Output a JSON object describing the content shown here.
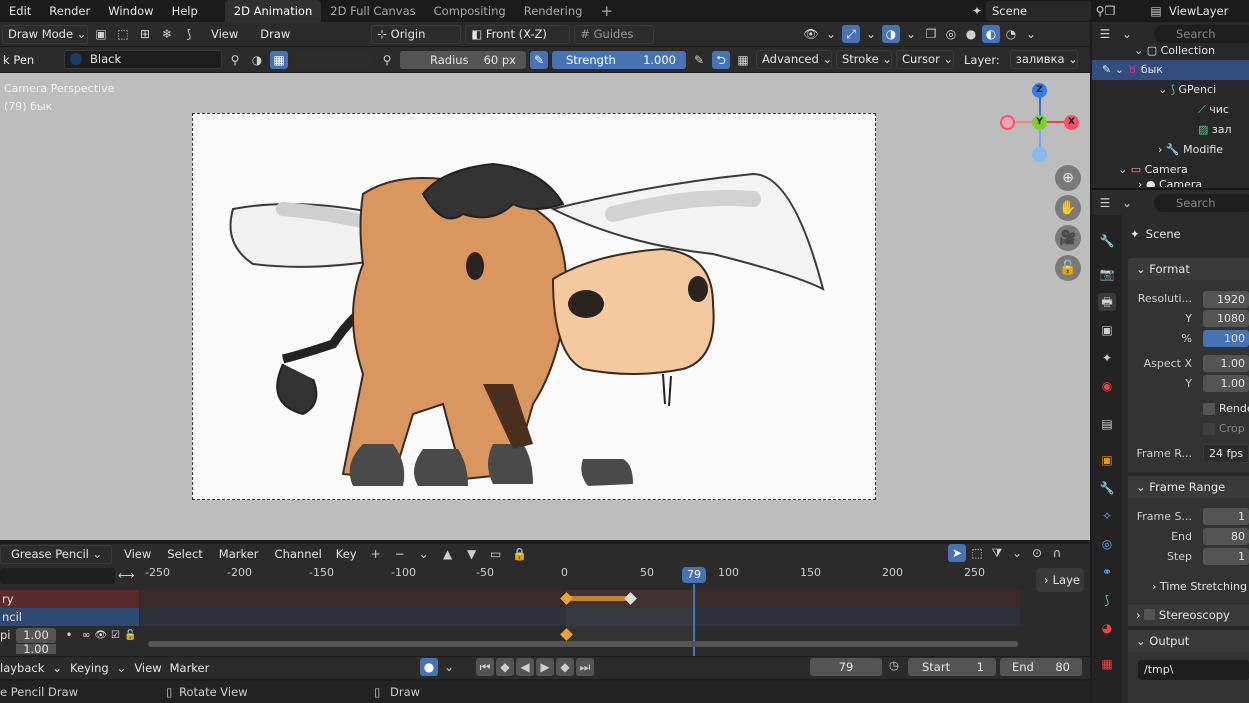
{
  "menus": [
    "Edit",
    "Render",
    "Window",
    "Help"
  ],
  "workspaces": [
    {
      "label": "2D Animation",
      "active": true
    },
    {
      "label": "2D Full Canvas",
      "active": false
    },
    {
      "label": "Compositing",
      "active": false
    },
    {
      "label": "Rendering",
      "active": false
    }
  ],
  "workspace_add": "+",
  "scene_name": "Scene",
  "view_layer_name": "ViewLayer",
  "toolbar1": {
    "mode": "Draw Mode",
    "view": "View",
    "draw": "Draw",
    "origin": "Origin",
    "front": "Front (X-Z)",
    "guides": "Guides"
  },
  "toolbar2": {
    "tool": "k Pen",
    "material": "Black",
    "radius_label": "Radius",
    "radius_value": "60 px",
    "strength_label": "Strength",
    "strength_value": "1.000",
    "advanced": "Advanced",
    "stroke": "Stroke",
    "cursor": "Cursor",
    "layer_label": "Layer:",
    "layer_value": "заливка"
  },
  "viewport": {
    "overlay_line1": "Camera Perspective",
    "overlay_line2": "(79) бык",
    "gizmo": {
      "z": "Z",
      "y": "Y",
      "x": "X"
    }
  },
  "dopesheet": {
    "mode": "Grease Pencil",
    "menus": [
      "View",
      "Select",
      "Marker",
      "Channel",
      "Key"
    ],
    "ruler": [
      "-250",
      "-200",
      "-150",
      "-100",
      "-50",
      "0",
      "50",
      "100",
      "150",
      "200",
      "250"
    ],
    "current_frame": "79",
    "channels": [
      {
        "label": "ry"
      },
      {
        "label": "ncil"
      },
      {
        "label": "pi",
        "value": "1.00"
      },
      {
        "label": "",
        "value": "1.00"
      }
    ],
    "layers_btn": "Laye"
  },
  "playback": {
    "playback": "layback",
    "keying": "Keying",
    "view": "View",
    "marker": "Marker",
    "frame": "79",
    "start_label": "Start",
    "start": "1",
    "end_label": "End",
    "end": "80"
  },
  "status": {
    "left": "e Pencil Draw",
    "middle": "Rotate View",
    "right": "Draw"
  },
  "outliner": {
    "search_placeholder": "Search",
    "items": [
      {
        "label": "Collection"
      },
      {
        "label": "бык"
      },
      {
        "label": "GPenci"
      },
      {
        "label": "чис"
      },
      {
        "label": "зал"
      },
      {
        "label": "Modifie"
      },
      {
        "label": "Camera"
      },
      {
        "label": "Camera"
      }
    ]
  },
  "properties": {
    "search_placeholder": "Search",
    "scene": "Scene",
    "format": "Format",
    "resolution_label": "Resoluti...",
    "res_x": "1920",
    "y_label": "Y",
    "res_y": "1080",
    "pct_label": "%",
    "res_pct": "100",
    "aspect_x_label": "Aspect X",
    "aspect_x": "1.00",
    "aspect_y_label": "Y",
    "aspect_y": "1.00",
    "render_region": "Rende",
    "crop": "Crop",
    "frame_rate_label": "Frame R...",
    "frame_rate": "24 fps",
    "frame_range": "Frame Range",
    "frame_start_label": "Frame S...",
    "frame_start": "1",
    "end_label": "End",
    "end": "80",
    "step_label": "Step",
    "step": "1",
    "time_stretching": "Time Stretching",
    "stereoscopy": "Stereoscopy",
    "output": "Output",
    "output_path": "/tmp\\"
  },
  "colors": {
    "accent": "#4772b3",
    "keyframe": "#e8a33a",
    "playhead": "#4772b3"
  }
}
